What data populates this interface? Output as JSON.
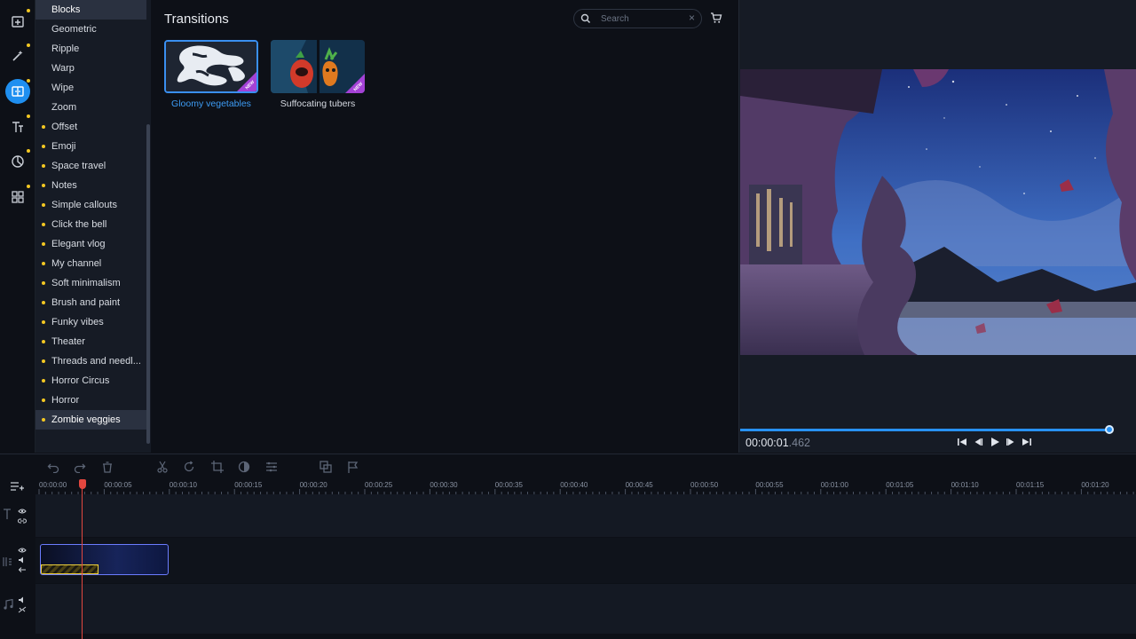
{
  "sidebar": {
    "categories": [
      {
        "label": "Blocks",
        "dot": false
      },
      {
        "label": "Geometric",
        "dot": false
      },
      {
        "label": "Ripple",
        "dot": false
      },
      {
        "label": "Warp",
        "dot": false
      },
      {
        "label": "Wipe",
        "dot": false
      },
      {
        "label": "Zoom",
        "dot": false
      },
      {
        "label": "Offset",
        "dot": true
      },
      {
        "label": "Emoji",
        "dot": true
      },
      {
        "label": "Space travel",
        "dot": true
      },
      {
        "label": "Notes",
        "dot": true
      },
      {
        "label": "Simple callouts",
        "dot": true
      },
      {
        "label": "Click the bell",
        "dot": true
      },
      {
        "label": "Elegant vlog",
        "dot": true
      },
      {
        "label": "My channel",
        "dot": true
      },
      {
        "label": "Soft minimalism",
        "dot": true
      },
      {
        "label": "Brush and paint",
        "dot": true
      },
      {
        "label": "Funky vibes",
        "dot": true
      },
      {
        "label": "Theater",
        "dot": true
      },
      {
        "label": "Threads and needl...",
        "dot": true
      },
      {
        "label": "Horror Circus",
        "dot": true
      },
      {
        "label": "Horror",
        "dot": true
      },
      {
        "label": "Zombie veggies",
        "dot": true
      }
    ],
    "selected_first": "Blocks",
    "selected_last": "Zombie veggies"
  },
  "panel": {
    "title": "Transitions",
    "search_placeholder": "Search",
    "clear_glyph": "×",
    "items": [
      {
        "name": "Gloomy vegetables",
        "badge": "NEW",
        "selected": true
      },
      {
        "name": "Suffocating tubers",
        "badge": "NEW",
        "selected": false
      }
    ]
  },
  "preview": {
    "time_main": "00:00:01",
    "time_ms": ".462",
    "progress_fraction": 0.93
  },
  "timeline": {
    "ruler": [
      "00:00:00",
      "00:00:05",
      "00:00:10",
      "00:00:15",
      "00:00:20",
      "00:00:25",
      "00:00:30",
      "00:00:35",
      "00:00:40",
      "00:00:45",
      "00:00:50",
      "00:00:55",
      "00:01:00",
      "00:01:05",
      "00:01:10",
      "00:01:15",
      "00:01:20"
    ]
  },
  "colors": {
    "accent": "#1f8ff0",
    "new_badge": "#a442d6",
    "category_dot": "#f3c722",
    "playhead": "#e2473f"
  }
}
